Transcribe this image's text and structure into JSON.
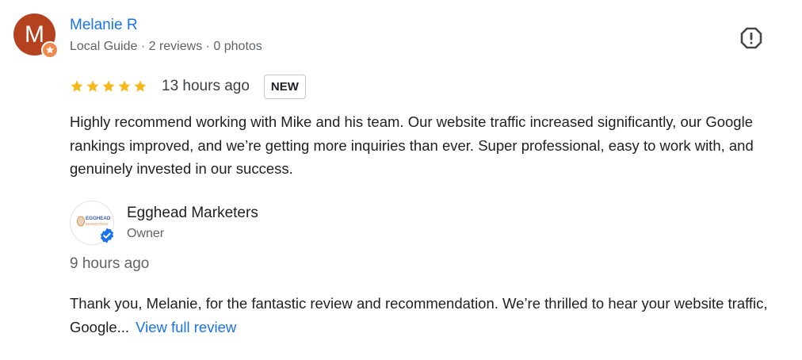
{
  "reviewer": {
    "initial": "M",
    "name": "Melanie R",
    "meta": "Local Guide · 2 reviews · 0 photos",
    "avatar_color": "#b5421f",
    "badge_icon": "local-guide-star-icon"
  },
  "review": {
    "rating": 5,
    "max_rating": 5,
    "time": "13 hours ago",
    "badge": "NEW",
    "text": "Highly recommend working with Mike and his team. Our website traffic increased significantly, our Google rankings improved, and we’re getting more inquiries than ever. Super professional, easy to work with, and genuinely invested in our success.",
    "star_color": "#f6b817",
    "report_icon": "report-icon"
  },
  "owner_reply": {
    "name": "Egghead Marketers",
    "role": "Owner",
    "logo_text_top": "EGGHEAD",
    "logo_text_bottom": "MARKETERS",
    "verified_icon": "verified-check-icon",
    "time": "9 hours ago",
    "text": "Thank you, Melanie, for the fantastic review and recommendation. We’re thrilled to hear your website traffic, Google...",
    "view_full_label": "View full review"
  },
  "colors": {
    "link": "#1a73e8",
    "secondary_text": "#5f6368",
    "verified": "#1a73e8"
  }
}
